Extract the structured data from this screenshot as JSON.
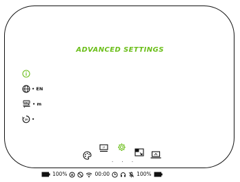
{
  "screen": {
    "title": "ADVANCED SETTINGS",
    "accent_color": "#6cbf1b",
    "frame_color": "#111111"
  },
  "settings": [
    {
      "icon": "info-icon",
      "value": ""
    },
    {
      "icon": "language-icon",
      "value": "• EN"
    },
    {
      "icon": "units-icon",
      "value": "• m"
    },
    {
      "icon": "timer-icon",
      "value": "•"
    }
  ],
  "menu": {
    "items": [
      {
        "icon": "palette-icon",
        "active": false
      },
      {
        "icon": "display-icon",
        "active": false
      },
      {
        "icon": "settings-gear-icon",
        "active": true
      },
      {
        "icon": "picture-in-picture-icon",
        "active": false
      },
      {
        "icon": "laptop-icon",
        "active": false
      }
    ],
    "pager": ". . ."
  },
  "status_bar": {
    "battery_left": "100%",
    "time": "00:00",
    "battery_right": "100%"
  }
}
